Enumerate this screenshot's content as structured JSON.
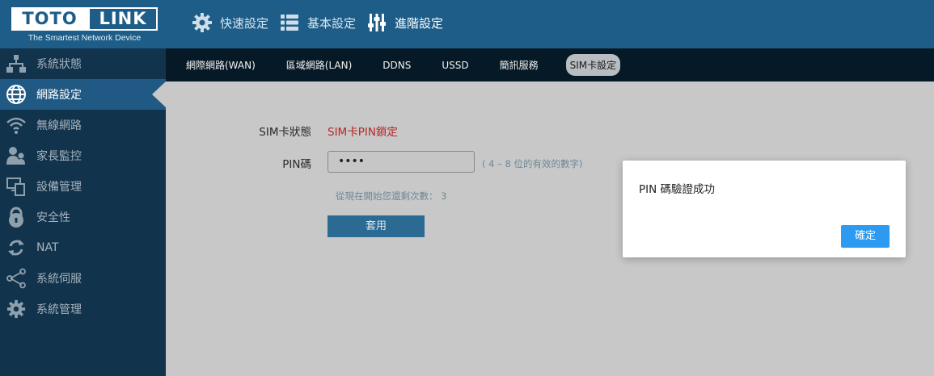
{
  "brand": {
    "logo_left": "TOTO",
    "logo_right": "LINK",
    "tagline": "The Smartest Network Device"
  },
  "top_nav": [
    {
      "label": "快速設定",
      "icon": "gear-icon"
    },
    {
      "label": "基本設定",
      "icon": "list-icon"
    },
    {
      "label": "進階設定",
      "icon": "sliders-icon",
      "active": true
    }
  ],
  "sidebar": {
    "items": [
      {
        "label": "系統狀態",
        "icon": "network-status-icon"
      },
      {
        "label": "網路設定",
        "icon": "globe-icon",
        "active": true
      },
      {
        "label": "無線網路",
        "icon": "wifi-icon"
      },
      {
        "label": "家長監控",
        "icon": "parental-control-icon"
      },
      {
        "label": "設備管理",
        "icon": "devices-icon"
      },
      {
        "label": "安全性",
        "icon": "lock-icon"
      },
      {
        "label": "NAT",
        "icon": "refresh-icon"
      },
      {
        "label": "系統伺服",
        "icon": "share-icon"
      },
      {
        "label": "系統管理",
        "icon": "gear-icon"
      }
    ]
  },
  "sub_nav": {
    "tabs": [
      {
        "label": "網際網路(WAN)"
      },
      {
        "label": "區域網路(LAN)"
      },
      {
        "label": "DDNS"
      },
      {
        "label": "USSD"
      },
      {
        "label": "簡訊服務"
      },
      {
        "label": "SIM卡設定",
        "active": true
      }
    ]
  },
  "form": {
    "sim_status_label": "SIM卡狀態",
    "sim_status_value": "SIM卡PIN鎖定",
    "pin_label": "PIN碼",
    "pin_value": "••••",
    "pin_hint": "( 4 – 8 位的有效的數字)",
    "remaining_attempts": "從現在開始您還剩次數： 3",
    "apply_label": "套用"
  },
  "dialog": {
    "message": "PIN 碼驗證成功",
    "ok_label": "確定"
  },
  "colors": {
    "header_bg": "#1d5d88",
    "sidebar_bg": "#11334c",
    "subnav_bg": "#061926",
    "status_error": "#b52727",
    "dialog_button": "#2c9af0"
  }
}
